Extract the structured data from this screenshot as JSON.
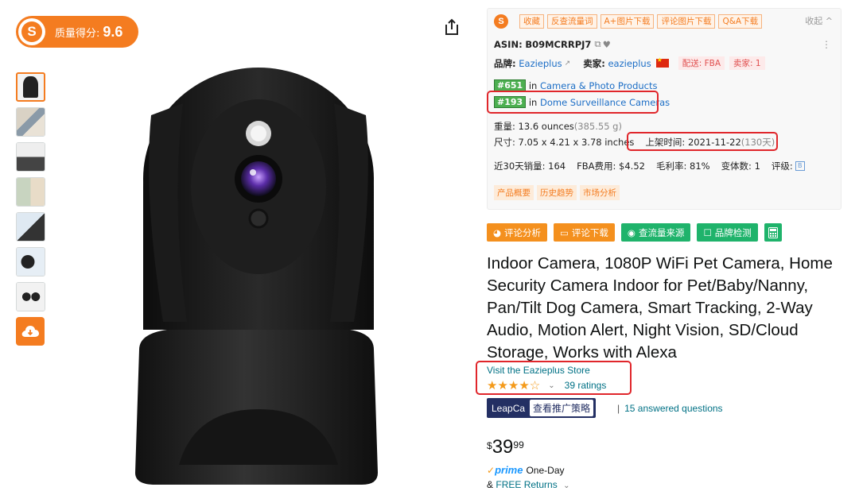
{
  "score_badge": {
    "logo": "S",
    "label": "质量得分:",
    "value": "9.6"
  },
  "gallery": {
    "thumbnail_count": 7,
    "selected_index": 0,
    "cloud_icon": "cloud-download-icon"
  },
  "share_icon": "share-icon",
  "plugin": {
    "logo": "S",
    "tabs": [
      "收藏",
      "反查流量词",
      "A+图片下载",
      "评论图片下载",
      "Q&A下载"
    ],
    "collapse_label": "收起 ^",
    "asin_label": "ASIN:",
    "asin": "B09MCRRPJ7",
    "brand_label": "品牌:",
    "brand": "Eazieplus",
    "seller_label": "卖家:",
    "seller": "eazieplus",
    "fulfillment_tag": "配送: FBA",
    "seller_count_tag": "卖家: 1",
    "rank1_num": "#651",
    "rank1_in": "in",
    "rank1_cat": "Camera & Photo Products",
    "rank2_num": "#193",
    "rank2_in": "in",
    "rank2_cat": "Dome Surveillance Cameras",
    "weight_label": "重量:",
    "weight": "13.6 ounces",
    "weight_g": "(385.55 g)",
    "size_label": "尺寸:",
    "size": "7.05 x 4.21 x 3.78 inches",
    "listed_label": "上架时间:",
    "listed_date": "2021-11-22",
    "listed_days": "(130天)",
    "sales_label": "近30天销量:",
    "sales": "164",
    "fba_label": "FBA费用:",
    "fba": "$4.52",
    "margin_label": "毛利率:",
    "margin": "81%",
    "variants_label": "变体数:",
    "variants": "1",
    "rating_label": "评级:",
    "rating_btn": "B",
    "bottom_tags": [
      "产品概要",
      "历史趋势",
      "市场分析"
    ]
  },
  "actions": [
    {
      "label": "评论分析",
      "icon": "pie-icon",
      "color": "#f4901e"
    },
    {
      "label": "评论下载",
      "icon": "comment-icon",
      "color": "#f4901e"
    },
    {
      "label": "查流量来源",
      "icon": "compass-icon",
      "color": "#1fb36b"
    },
    {
      "label": "品牌检测",
      "icon": "square-icon",
      "color": "#1fb36b"
    }
  ],
  "calculator_icon": "calculator-icon",
  "product": {
    "title": "Indoor Camera, 1080P WiFi Pet Camera, Home Security Camera Indoor for Pet/Baby/Nanny, Pan/Tilt Dog Camera, Smart Tracking, 2-Way Audio, Motion Alert, Night Vision, SD/Cloud Storage, Works with Alexa",
    "store_link": "Visit the Eazieplus Store",
    "stars": "★★★★☆",
    "rating_value": 4.0,
    "chevron": "⌄",
    "ratings_count": "39 ratings",
    "leap_name": "LeapCa",
    "leap_cta": "查看推广策略",
    "qa_sep": "|",
    "qa_link": "15 answered questions",
    "price_currency": "$",
    "price_whole": "39",
    "price_fraction": "99",
    "prime_check": "✓",
    "prime_logo": "prime",
    "prime_delivery": "One-Day",
    "returns_prefix": "&",
    "returns_link": "FREE Returns",
    "returns_chevron": "⌄"
  }
}
